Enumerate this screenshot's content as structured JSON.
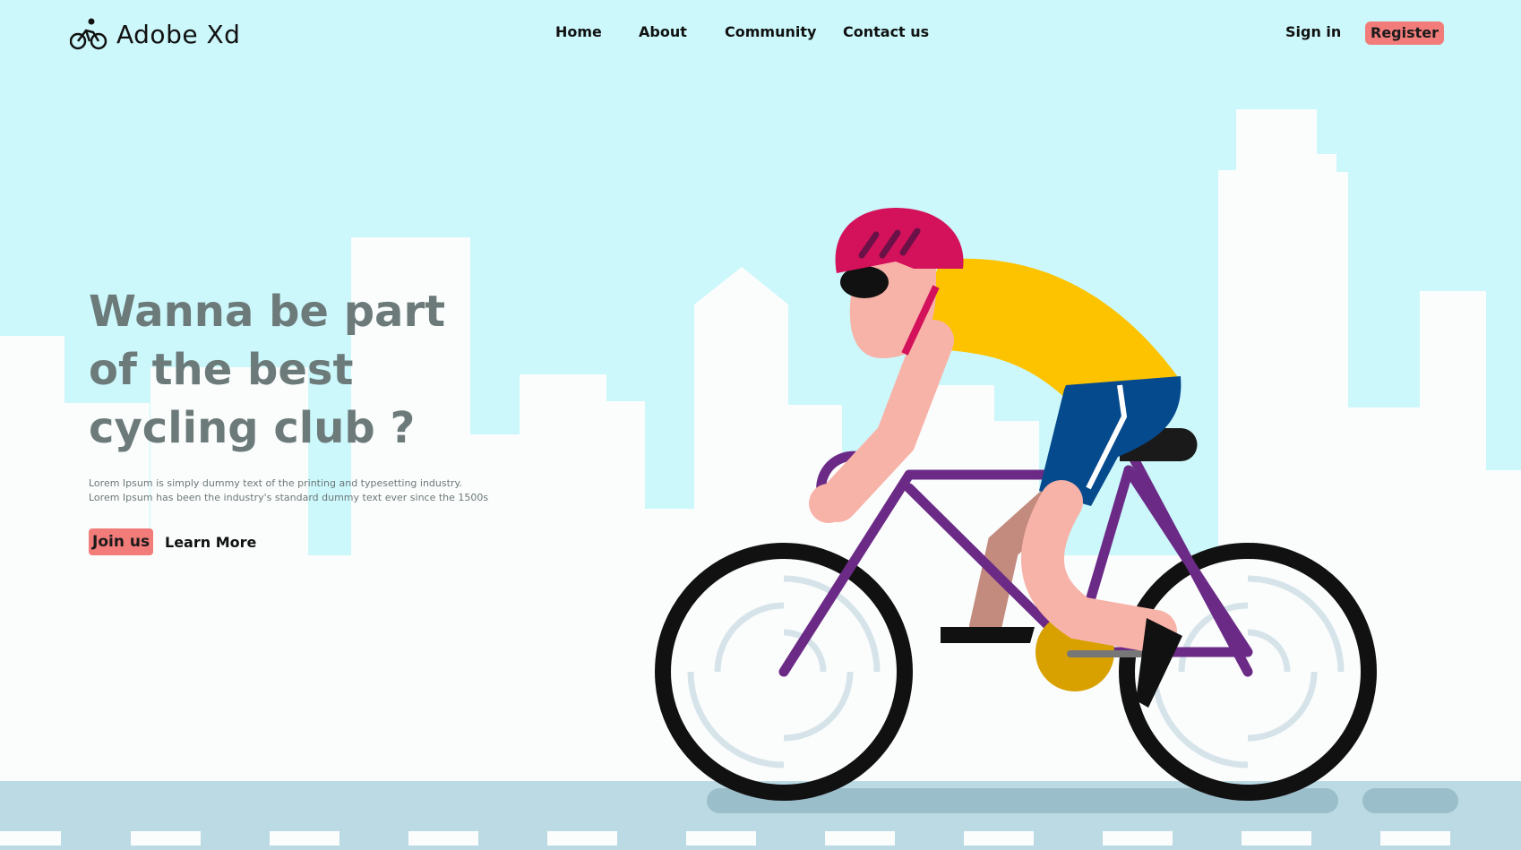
{
  "brand": {
    "name": "Adobe Xd",
    "logo_icon": "cyclist-icon"
  },
  "nav": {
    "links": [
      {
        "label": "Home"
      },
      {
        "label": "About"
      },
      {
        "label": "Community"
      },
      {
        "label": "Contact us"
      }
    ],
    "sign_in": "Sign in",
    "register": "Register"
  },
  "hero": {
    "title_lines": [
      "Wanna be part",
      "of the best",
      "cycling club ?"
    ],
    "description_lines": [
      "Lorem Ipsum is simply dummy text of the printing and typesetting industry.",
      "Lorem Ipsum has been the industry's standard dummy text ever since the 1500s"
    ],
    "join_label": "Join us",
    "learn_more_label": "Learn More"
  },
  "colors": {
    "sky": "#ccf8fb",
    "buildings": "#fbfdfd",
    "road": "#bbdae3",
    "accent": "#f27c7a",
    "jersey": "#fdc300",
    "helmet": "#d4115b",
    "frame": "#6b2a86",
    "shorts": "#064a8e"
  }
}
